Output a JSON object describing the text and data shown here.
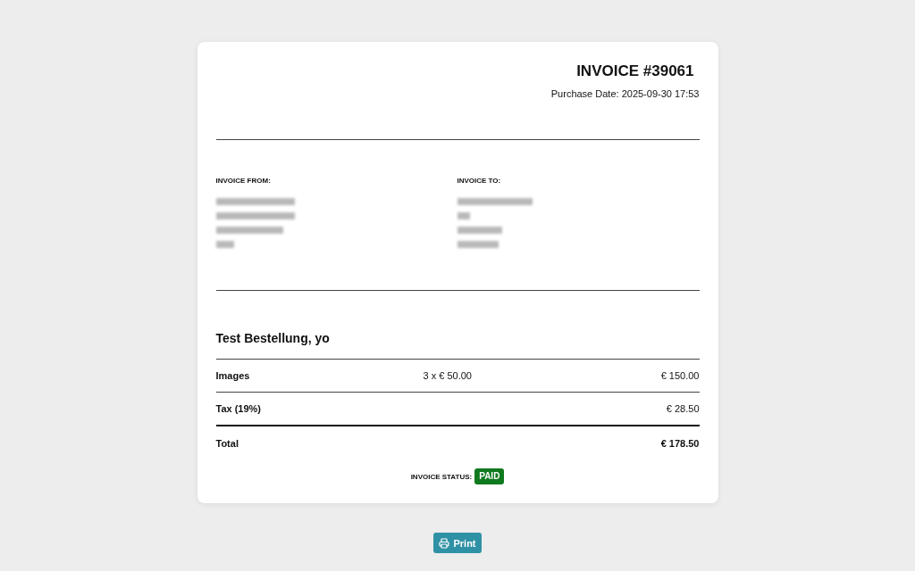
{
  "invoice": {
    "title": "INVOICE #39061",
    "purchase_date": "Purchase Date: 2025-09-30 17:53"
  },
  "parties": [
    {
      "label": "INVOICE FROM:",
      "lines": [
        {
          "kind": "redacted"
        },
        {
          "kind": "redacted"
        },
        {
          "kind": "redacted"
        },
        {
          "kind": "redacted"
        }
      ]
    },
    {
      "label": "INVOICE TO:",
      "lines": [
        {
          "kind": "redacted"
        },
        {
          "kind": "redacted"
        },
        {
          "kind": "redacted"
        },
        {
          "kind": "redacted"
        }
      ]
    }
  ],
  "order": {
    "title": "Test Bestellung, yo",
    "rows": [
      {
        "kind": "item",
        "label": "Images",
        "quantity": "3 x € 50.00",
        "amount": "€ 150.00"
      },
      {
        "kind": "tax",
        "label": "Tax (19%)",
        "amount": "€ 28.50"
      },
      {
        "kind": "total",
        "label": "Total",
        "amount": "€ 178.50"
      }
    ]
  },
  "status": {
    "label": "INVOICE STATUS:",
    "value": "PAID",
    "paid": true
  },
  "print_button": {
    "label": "Print"
  }
}
